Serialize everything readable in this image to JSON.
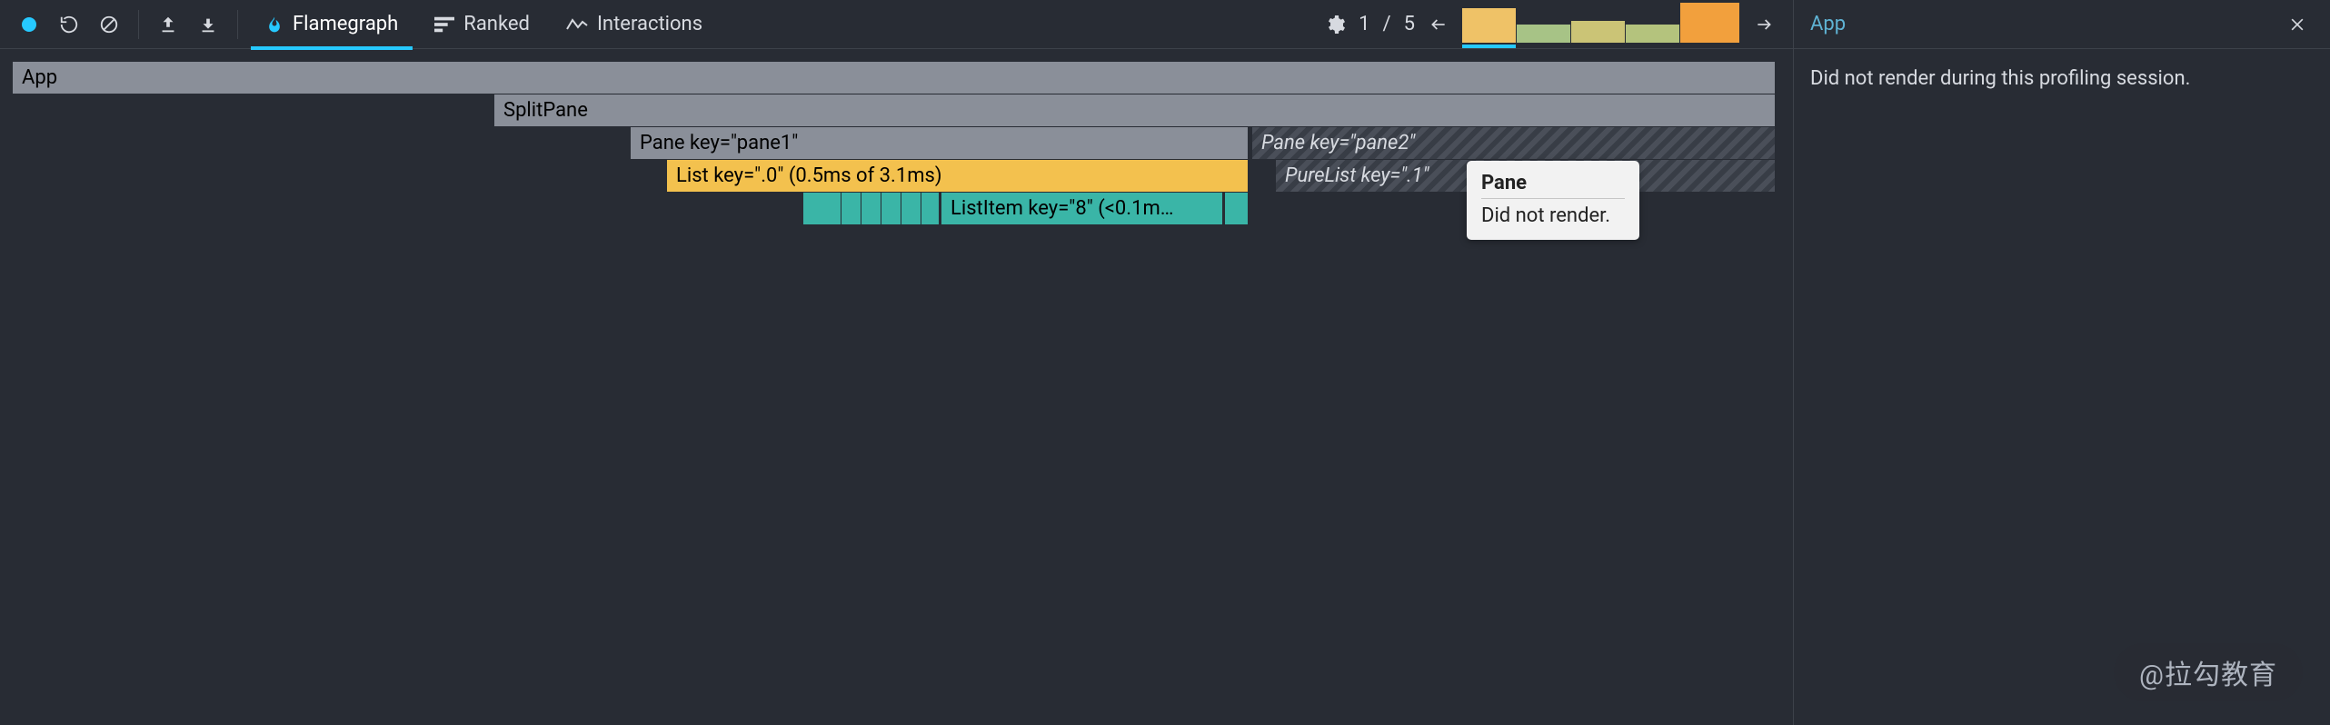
{
  "toolbar": {
    "tabs": {
      "flamegraph": "Flamegraph",
      "ranked": "Ranked",
      "interactions": "Interactions"
    },
    "commit_counter": {
      "current": "1",
      "sep": "/",
      "total": "5"
    }
  },
  "sidebar": {
    "title": "App",
    "body": "Did not render during this profiling session."
  },
  "flame": {
    "rows": {
      "r0_app": "App",
      "r1_split": "SplitPane",
      "r2_pane1": "Pane key=\"pane1\"",
      "r2_pane2": "Pane key=\"pane2\"",
      "r3_list": "List key=\".0\" (0.5ms of 3.1ms)",
      "r3_purelist": "PureList key=\".1\"",
      "r4_listitem": "ListItem key=\"8\" (<0.1m…"
    }
  },
  "tooltip": {
    "title": "Pane",
    "body": "Did not render."
  },
  "watermark": "@拉勾教育"
}
